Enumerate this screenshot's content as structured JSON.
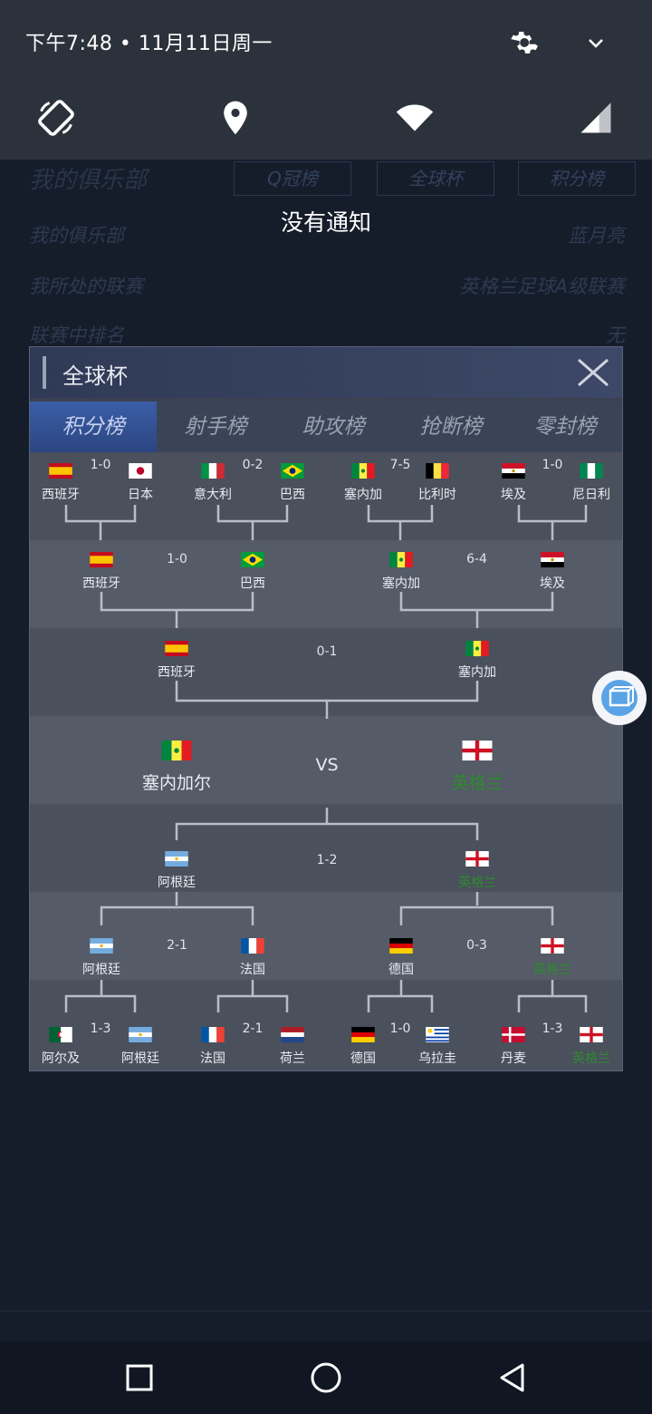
{
  "status_bar": {
    "time_date": "下午7:48 • 11月11日周一",
    "icons": [
      "gear-icon",
      "chevron-down-icon",
      "auto-rotate-icon",
      "location-icon",
      "wifi-icon",
      "signal-icon"
    ]
  },
  "notification_shade": {
    "empty_text": "没有通知"
  },
  "background": {
    "title": "我的俱乐部",
    "tabs": [
      "Q冠榜",
      "全球杯",
      "积分榜"
    ],
    "rows": [
      {
        "label": "我的俱乐部",
        "value": "蓝月亮"
      },
      {
        "label": "我所处的联赛",
        "value": "英格兰足球A级联赛"
      },
      {
        "label": "联赛中排名",
        "value": "无"
      }
    ]
  },
  "panel": {
    "title": "全球杯",
    "tabs": [
      "积分榜",
      "射手榜",
      "助攻榜",
      "抢断榜",
      "零封榜"
    ],
    "active_tab": 0
  },
  "bracket": {
    "top_r16": [
      {
        "score": "1-0",
        "a": "西班牙",
        "b": "日本",
        "fa": "spain",
        "fb": "japan"
      },
      {
        "score": "0-2",
        "a": "意大利",
        "b": "巴西",
        "fa": "italy",
        "fb": "brazil"
      },
      {
        "score": "7-5",
        "a": "塞内加",
        "b": "比利时",
        "fa": "senegal",
        "fb": "belgium"
      },
      {
        "score": "1-0",
        "a": "埃及",
        "b": "尼日利",
        "fa": "egypt",
        "fb": "nigeria"
      }
    ],
    "top_qf": [
      {
        "score": "1-0",
        "a": "西班牙",
        "b": "巴西",
        "fa": "spain",
        "fb": "brazil"
      },
      {
        "score": "6-4",
        "a": "塞内加",
        "b": "埃及",
        "fa": "senegal",
        "fb": "egypt"
      }
    ],
    "top_sf": {
      "score": "0-1",
      "a": "西班牙",
      "b": "塞内加",
      "fa": "spain",
      "fb": "senegal"
    },
    "final": {
      "a": "塞内加尔",
      "vs": "VS",
      "b": "英格兰",
      "fa": "senegal",
      "fb": "england"
    },
    "bottom_sf": {
      "score": "1-2",
      "a": "阿根廷",
      "b": "英格兰",
      "fa": "argentina",
      "fb": "england"
    },
    "bottom_qf": [
      {
        "score": "2-1",
        "a": "阿根廷",
        "b": "法国",
        "fa": "argentina",
        "fb": "france"
      },
      {
        "score": "0-3",
        "a": "德国",
        "b": "英格兰",
        "fa": "germany",
        "fb": "england"
      }
    ],
    "bottom_r16": [
      {
        "score": "1-3",
        "a": "阿尔及",
        "b": "阿根廷",
        "fa": "algeria",
        "fb": "argentina"
      },
      {
        "score": "2-1",
        "a": "法国",
        "b": "荷兰",
        "fa": "france",
        "fb": "netherlands"
      },
      {
        "score": "1-0",
        "a": "德国",
        "b": "乌拉圭",
        "fa": "germany",
        "fb": "uruguay"
      },
      {
        "score": "1-3",
        "a": "丹麦",
        "b": "英格兰",
        "fa": "denmark",
        "fb": "england"
      }
    ]
  },
  "colors": {
    "winner_green": "#2f8a2f",
    "active_tab": "#3b5ea8"
  },
  "nav": [
    "recents-button",
    "home-button",
    "back-button"
  ]
}
